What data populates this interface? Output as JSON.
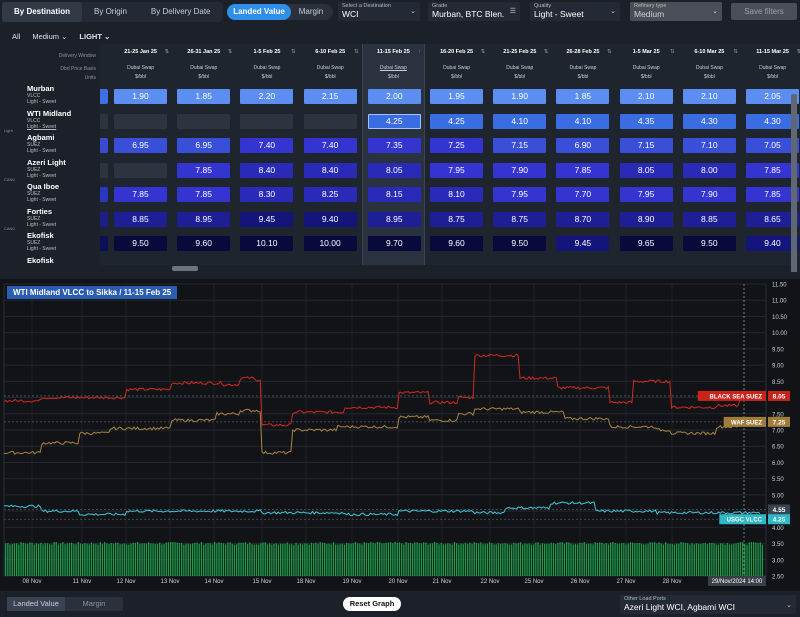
{
  "toolbar": {
    "view_tabs": [
      {
        "label": "By Destination",
        "active": true
      },
      {
        "label": "By Origin",
        "active": false
      },
      {
        "label": "By Delivery Date",
        "active": false
      }
    ],
    "value_toggle": {
      "landed": "Landed Value",
      "margin": "Margin"
    },
    "destination": {
      "caption": "Select a Destination",
      "value": "WCI"
    },
    "grade": {
      "caption": "Grade",
      "value": "Murban, BTC Blen..."
    },
    "quality": {
      "caption": "Quality",
      "value": "Light - Sweet"
    },
    "refinery": {
      "caption": "Refinery type",
      "value": "Medium"
    },
    "save_filters": "Save filters"
  },
  "filters_row": {
    "all": "All",
    "medium": "Medium",
    "light": "LIGHT"
  },
  "matrix": {
    "row_header_labels": {
      "delivery_window": "Delivery Window",
      "dbd_price_basis": "Dbd Price Basis",
      "units": "Units"
    },
    "columns": [
      {
        "window": "21-25 Jan 25",
        "basis": "Dubai Swap",
        "unit": "$/bbl"
      },
      {
        "window": "26-31 Jan 25",
        "basis": "Dubai Swap",
        "unit": "$/bbl"
      },
      {
        "window": "1-5 Feb 25",
        "basis": "Dubai Swap",
        "unit": "$/bbl"
      },
      {
        "window": "6-10 Feb 25",
        "basis": "Dubai Swap",
        "unit": "$/bbl"
      },
      {
        "window": "11-15 Feb 25",
        "basis": "Dubai Swap",
        "unit": "$/bbl",
        "selected": true
      },
      {
        "window": "16-20 Feb 25",
        "basis": "Dubai Swap",
        "unit": "$/bbl"
      },
      {
        "window": "21-25 Feb 25",
        "basis": "Dubai Swap",
        "unit": "$/bbl"
      },
      {
        "window": "26-28 Feb 25",
        "basis": "Dubai Swap",
        "unit": "$/bbl"
      },
      {
        "window": "1-5 Mar 25",
        "basis": "Dubai Swap",
        "unit": "$/bbl"
      },
      {
        "window": "6-10 Mar 25",
        "basis": "Dubai Swap",
        "unit": "$/bbl"
      },
      {
        "window": "11-15 Mar 25",
        "basis": "Dubai Swap",
        "unit": "$/bbl"
      }
    ],
    "rows": [
      {
        "name": "Murban",
        "ship": "VLCC",
        "quality": "Light - Sweet",
        "edge_color": "#3f6fe0",
        "values": [
          "1.90",
          "1.85",
          "2.20",
          "2.15",
          "2.00",
          "1.95",
          "1.90",
          "1.85",
          "2.10",
          "2.10",
          "2.05"
        ]
      },
      {
        "name": "WTI Midland",
        "ship": "VLCC",
        "quality": "Light - Sweet",
        "quality_underlined": true,
        "edge_color": "#2d3440",
        "values": [
          "",
          "",
          "",
          "",
          "4.25",
          "4.25",
          "4.10",
          "4.10",
          "4.35",
          "4.30",
          "4.30"
        ]
      },
      {
        "name": "Agbami",
        "ship": "SUEZ",
        "quality": "Light - Sweet",
        "edge_color": "#3a4bd0",
        "values": [
          "6.95",
          "6.95",
          "7.40",
          "7.40",
          "7.35",
          "7.25",
          "7.15",
          "6.90",
          "7.15",
          "7.10",
          "7.05"
        ]
      },
      {
        "name": "Azeri Light",
        "ship": "SUEZ",
        "quality": "Light - Sweet",
        "edge_color": "#2d3440",
        "values": [
          "",
          "7.85",
          "8.40",
          "8.40",
          "8.05",
          "7.95",
          "7.90",
          "7.85",
          "8.05",
          "8.00",
          "7.85"
        ]
      },
      {
        "name": "Qua Iboe",
        "ship": "SUEZ",
        "quality": "Light - Sweet",
        "edge_color": "#2a35c0",
        "values": [
          "7.85",
          "7.85",
          "8.30",
          "8.25",
          "8.15",
          "8.10",
          "7.95",
          "7.70",
          "7.95",
          "7.90",
          "7.85"
        ]
      },
      {
        "name": "Forties",
        "ship": "SUEZ",
        "quality": "Light - Sweet",
        "edge_color": "#1c1f8a",
        "values": [
          "8.85",
          "8.95",
          "9.45",
          "9.40",
          "8.95",
          "8.75",
          "8.75",
          "8.70",
          "8.90",
          "8.85",
          "8.65"
        ]
      },
      {
        "name": "Ekofisk",
        "ship": "SUEZ",
        "quality": "Light - Sweet",
        "edge_color": "#0d0f55",
        "values": [
          "9.50",
          "9.60",
          "10.10",
          "10.00",
          "9.70",
          "9.60",
          "9.50",
          "9.45",
          "9.65",
          "9.50",
          "9.40"
        ]
      },
      {
        "name": "Ekofisk",
        "ship": "",
        "quality": "",
        "edge_color": "#1b2029",
        "values": []
      }
    ],
    "side_tags": [
      "Light",
      "CAN0",
      "CAN0"
    ]
  },
  "graph": {
    "title": "WTI Midland VLCC to Sikka / 11-15 Feb 25",
    "y_ticks": [
      "11.50",
      "11.00",
      "10.50",
      "10.00",
      "9.50",
      "9.00",
      "8.50",
      "8.00",
      "7.50",
      "7.00",
      "6.50",
      "6.00",
      "5.50",
      "5.00",
      "4.50",
      "4.00",
      "3.50",
      "3.00",
      "2.50"
    ],
    "x_ticks": [
      "08 Nov",
      "11 Nov",
      "12 Nov",
      "13 Nov",
      "14 Nov",
      "15 Nov",
      "18 Nov",
      "19 Nov",
      "20 Nov",
      "21 Nov",
      "22 Nov",
      "25 Nov",
      "26 Nov",
      "27 Nov",
      "28 Nov"
    ],
    "crosshair_date": "29/Nov/2024 14:00",
    "series_labels": [
      {
        "name": "BLACK SEA SUEZ",
        "value": "8.05",
        "color": "#c8241c"
      },
      {
        "name": "WAF SUEZ",
        "value": "7.25",
        "color": "#a07c3a"
      },
      {
        "name": "",
        "value": "4.55",
        "color": "#3a4352"
      },
      {
        "name": "USGC VLCC",
        "value": "4.25",
        "color": "#2fb8c6"
      }
    ],
    "colors": {
      "red": "#d2281e",
      "tan": "#a98440",
      "cyan": "#3ec7d6",
      "green": "#1f9a4a"
    }
  },
  "bottom": {
    "landed": "Landed Value",
    "margin": "Margin",
    "reset": "Reset Graph",
    "other_ports_caption": "Other Load Ports",
    "other_ports_value": "Azeri Light WCI, Agbami WCI"
  }
}
